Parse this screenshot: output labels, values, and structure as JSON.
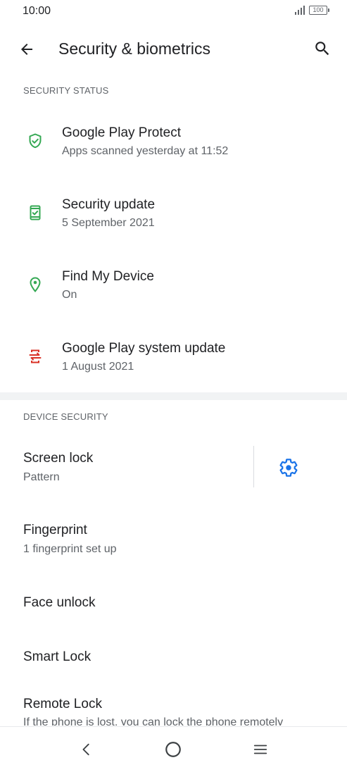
{
  "status_bar": {
    "time": "10:00",
    "battery": "100"
  },
  "app_bar": {
    "title": "Security & biometrics"
  },
  "sections": {
    "security_status": "SECURITY STATUS",
    "device_security": "DEVICE SECURITY"
  },
  "security_status_items": [
    {
      "title": "Google Play Protect",
      "subtitle": "Apps scanned yesterday at 11:52",
      "icon": "shield-check-icon",
      "color": "#34a853"
    },
    {
      "title": "Security update",
      "subtitle": "5 September 2021",
      "icon": "phone-check-icon",
      "color": "#34a853"
    },
    {
      "title": "Find My Device",
      "subtitle": "On",
      "icon": "location-pin-icon",
      "color": "#34a853"
    },
    {
      "title": "Google Play system update",
      "subtitle": "1 August 2021",
      "icon": "system-update-icon",
      "color": "#d93025"
    }
  ],
  "device_security_items": [
    {
      "title": "Screen lock",
      "subtitle": "Pattern"
    },
    {
      "title": "Fingerprint",
      "subtitle": "1 fingerprint set up"
    },
    {
      "title": "Face unlock"
    },
    {
      "title": "Smart Lock"
    },
    {
      "title": "Remote Lock",
      "subtitle": "If the phone is lost, you can lock the phone remotely"
    }
  ],
  "colors": {
    "accent": "#1a73e8",
    "green": "#34a853",
    "red": "#d93025"
  }
}
